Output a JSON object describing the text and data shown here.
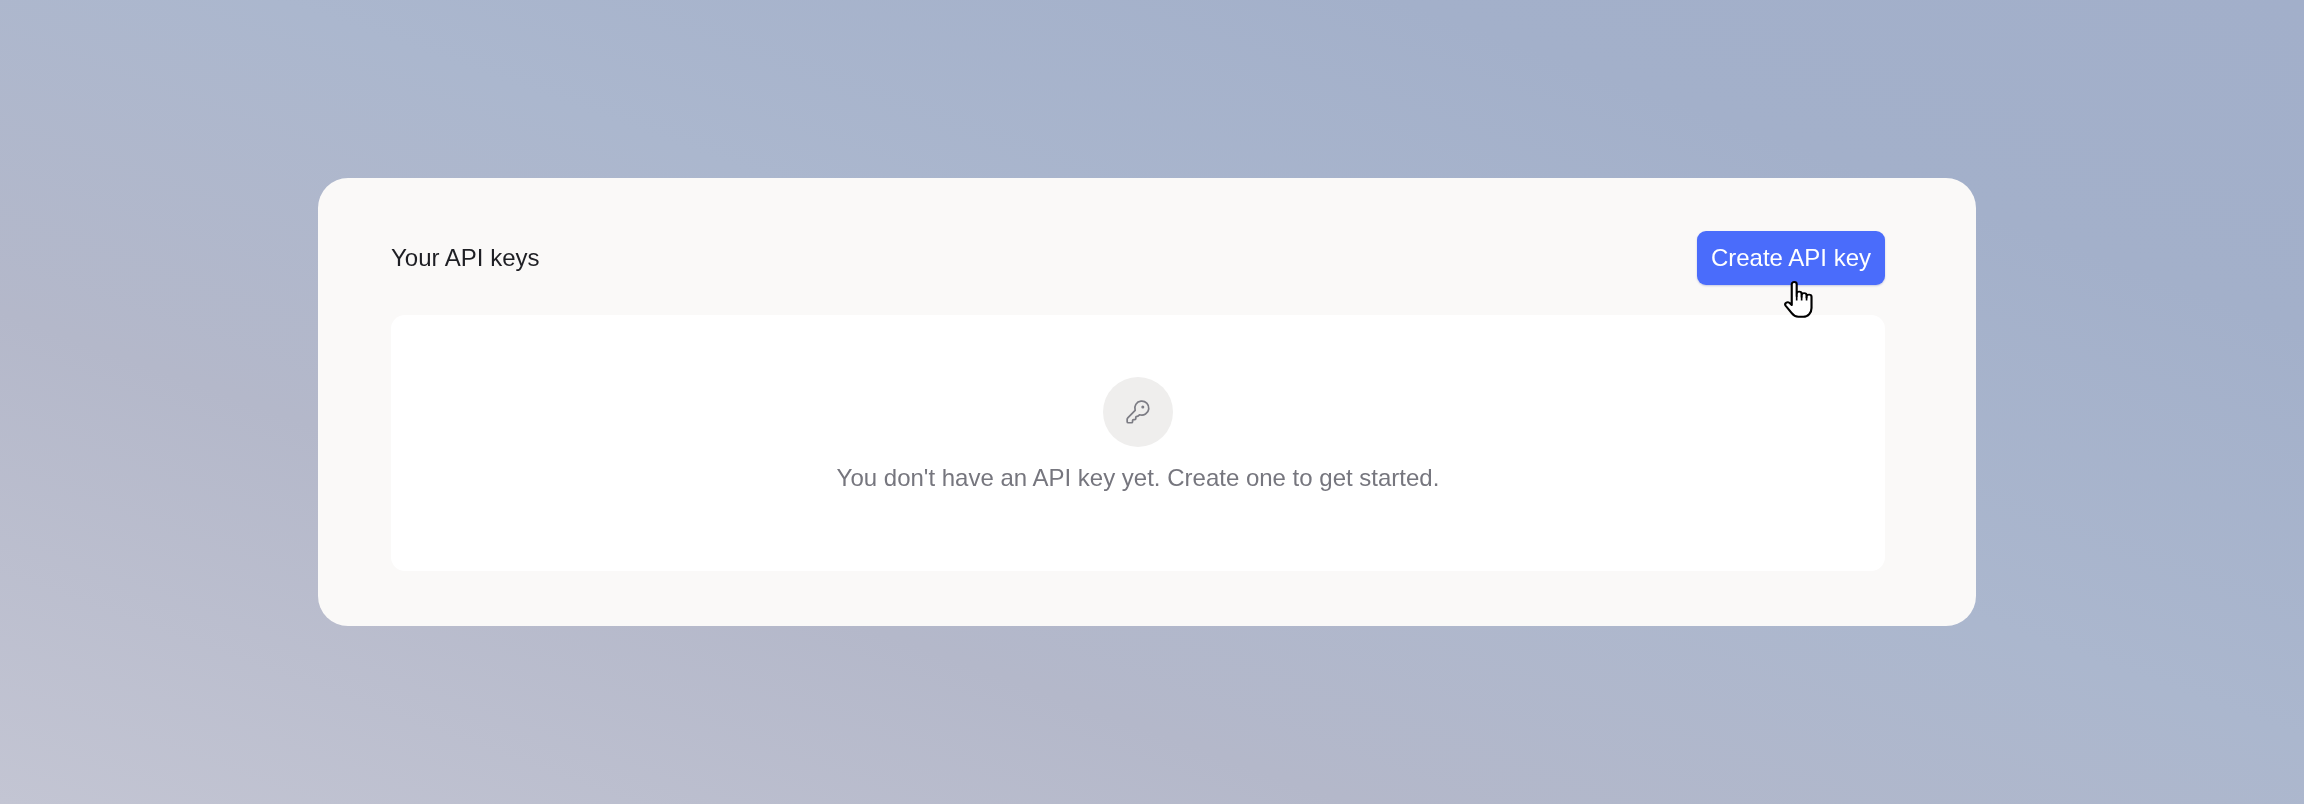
{
  "header": {
    "title": "Your API keys",
    "create_button": "Create API key"
  },
  "empty_state": {
    "message": "You don't have an API key yet. Create one to get started."
  }
}
